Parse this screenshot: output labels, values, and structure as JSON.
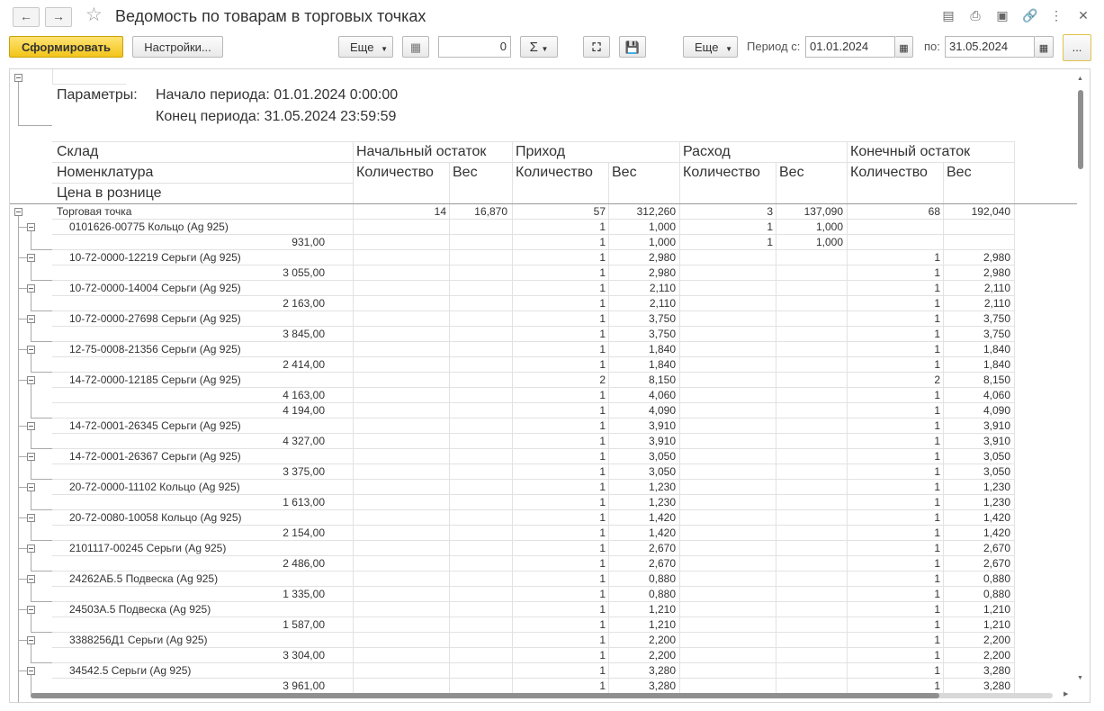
{
  "window": {
    "title": "Ведомость по товарам в торговых точках"
  },
  "toolbar": {
    "generate_label": "Сформировать",
    "settings_label": "Настройки...",
    "more1_label": "Еще",
    "number_value": "0",
    "sum_label": "Σ",
    "more2_label": "Еще",
    "period_from_label": "Период с:",
    "period_from_value": "01.01.2024",
    "period_to_label": "по:",
    "period_to_value": "31.05.2024",
    "ellipsis_label": "..."
  },
  "params": {
    "label": "Параметры:",
    "start": "Начало периода: 01.01.2024 0:00:00",
    "end": "Конец периода: 31.05.2024 23:59:59"
  },
  "headers": {
    "warehouse": "Склад",
    "nomenclature": "Номенклатура",
    "retail_price": "Цена в рознице",
    "opening": "Начальный остаток",
    "income": "Приход",
    "expense": "Расход",
    "closing": "Конечный остаток",
    "qty": "Количество",
    "weight": "Вес"
  },
  "total": {
    "name": "Торговая точка",
    "open_qty": "14",
    "open_w": "16,870",
    "in_qty": "57",
    "in_w": "312,260",
    "out_qty": "3",
    "out_w": "137,090",
    "close_qty": "68",
    "close_w": "192,040"
  },
  "rows": [
    {
      "name": "0101626-00775 Кольцо (Ag 925)",
      "in_qty": "1",
      "in_w": "1,000",
      "out_qty": "1",
      "out_w": "1,000",
      "close_qty": "",
      "close_w": "",
      "prices": [
        {
          "price": "931,00",
          "in_qty": "1",
          "in_w": "1,000",
          "out_qty": "1",
          "out_w": "1,000",
          "close_qty": "",
          "close_w": ""
        }
      ]
    },
    {
      "name": "10-72-0000-12219 Серьги (Ag 925)",
      "in_qty": "1",
      "in_w": "2,980",
      "out_qty": "",
      "out_w": "",
      "close_qty": "1",
      "close_w": "2,980",
      "prices": [
        {
          "price": "3 055,00",
          "in_qty": "1",
          "in_w": "2,980",
          "out_qty": "",
          "out_w": "",
          "close_qty": "1",
          "close_w": "2,980"
        }
      ]
    },
    {
      "name": "10-72-0000-14004 Серьги (Ag 925)",
      "in_qty": "1",
      "in_w": "2,110",
      "out_qty": "",
      "out_w": "",
      "close_qty": "1",
      "close_w": "2,110",
      "prices": [
        {
          "price": "2 163,00",
          "in_qty": "1",
          "in_w": "2,110",
          "out_qty": "",
          "out_w": "",
          "close_qty": "1",
          "close_w": "2,110"
        }
      ]
    },
    {
      "name": "10-72-0000-27698 Серьги (Ag 925)",
      "in_qty": "1",
      "in_w": "3,750",
      "out_qty": "",
      "out_w": "",
      "close_qty": "1",
      "close_w": "3,750",
      "prices": [
        {
          "price": "3 845,00",
          "in_qty": "1",
          "in_w": "3,750",
          "out_qty": "",
          "out_w": "",
          "close_qty": "1",
          "close_w": "3,750"
        }
      ]
    },
    {
      "name": "12-75-0008-21356 Серьги (Ag 925)",
      "in_qty": "1",
      "in_w": "1,840",
      "out_qty": "",
      "out_w": "",
      "close_qty": "1",
      "close_w": "1,840",
      "prices": [
        {
          "price": "2 414,00",
          "in_qty": "1",
          "in_w": "1,840",
          "out_qty": "",
          "out_w": "",
          "close_qty": "1",
          "close_w": "1,840"
        }
      ]
    },
    {
      "name": "14-72-0000-12185 Серьги (Ag 925)",
      "in_qty": "2",
      "in_w": "8,150",
      "out_qty": "",
      "out_w": "",
      "close_qty": "2",
      "close_w": "8,150",
      "prices": [
        {
          "price": "4 163,00",
          "in_qty": "1",
          "in_w": "4,060",
          "out_qty": "",
          "out_w": "",
          "close_qty": "1",
          "close_w": "4,060"
        },
        {
          "price": "4 194,00",
          "in_qty": "1",
          "in_w": "4,090",
          "out_qty": "",
          "out_w": "",
          "close_qty": "1",
          "close_w": "4,090"
        }
      ]
    },
    {
      "name": "14-72-0001-26345 Серьги (Ag 925)",
      "in_qty": "1",
      "in_w": "3,910",
      "out_qty": "",
      "out_w": "",
      "close_qty": "1",
      "close_w": "3,910",
      "prices": [
        {
          "price": "4 327,00",
          "in_qty": "1",
          "in_w": "3,910",
          "out_qty": "",
          "out_w": "",
          "close_qty": "1",
          "close_w": "3,910"
        }
      ]
    },
    {
      "name": "14-72-0001-26367 Серьги (Ag 925)",
      "in_qty": "1",
      "in_w": "3,050",
      "out_qty": "",
      "out_w": "",
      "close_qty": "1",
      "close_w": "3,050",
      "prices": [
        {
          "price": "3 375,00",
          "in_qty": "1",
          "in_w": "3,050",
          "out_qty": "",
          "out_w": "",
          "close_qty": "1",
          "close_w": "3,050"
        }
      ]
    },
    {
      "name": "20-72-0000-11102 Кольцо (Ag 925)",
      "in_qty": "1",
      "in_w": "1,230",
      "out_qty": "",
      "out_w": "",
      "close_qty": "1",
      "close_w": "1,230",
      "prices": [
        {
          "price": "1 613,00",
          "in_qty": "1",
          "in_w": "1,230",
          "out_qty": "",
          "out_w": "",
          "close_qty": "1",
          "close_w": "1,230"
        }
      ]
    },
    {
      "name": "20-72-0080-10058 Кольцо (Ag 925)",
      "in_qty": "1",
      "in_w": "1,420",
      "out_qty": "",
      "out_w": "",
      "close_qty": "1",
      "close_w": "1,420",
      "prices": [
        {
          "price": "2 154,00",
          "in_qty": "1",
          "in_w": "1,420",
          "out_qty": "",
          "out_w": "",
          "close_qty": "1",
          "close_w": "1,420"
        }
      ]
    },
    {
      "name": "2101117-00245 Серьги (Ag 925)",
      "in_qty": "1",
      "in_w": "2,670",
      "out_qty": "",
      "out_w": "",
      "close_qty": "1",
      "close_w": "2,670",
      "prices": [
        {
          "price": "2 486,00",
          "in_qty": "1",
          "in_w": "2,670",
          "out_qty": "",
          "out_w": "",
          "close_qty": "1",
          "close_w": "2,670"
        }
      ]
    },
    {
      "name": "24262АБ.5 Подвеска (Ag 925)",
      "in_qty": "1",
      "in_w": "0,880",
      "out_qty": "",
      "out_w": "",
      "close_qty": "1",
      "close_w": "0,880",
      "prices": [
        {
          "price": "1 335,00",
          "in_qty": "1",
          "in_w": "0,880",
          "out_qty": "",
          "out_w": "",
          "close_qty": "1",
          "close_w": "0,880"
        }
      ]
    },
    {
      "name": "24503А.5 Подвеска (Ag 925)",
      "in_qty": "1",
      "in_w": "1,210",
      "out_qty": "",
      "out_w": "",
      "close_qty": "1",
      "close_w": "1,210",
      "prices": [
        {
          "price": "1 587,00",
          "in_qty": "1",
          "in_w": "1,210",
          "out_qty": "",
          "out_w": "",
          "close_qty": "1",
          "close_w": "1,210"
        }
      ]
    },
    {
      "name": "3388256Д1 Серьги (Ag 925)",
      "in_qty": "1",
      "in_w": "2,200",
      "out_qty": "",
      "out_w": "",
      "close_qty": "1",
      "close_w": "2,200",
      "prices": [
        {
          "price": "3 304,00",
          "in_qty": "1",
          "in_w": "2,200",
          "out_qty": "",
          "out_w": "",
          "close_qty": "1",
          "close_w": "2,200"
        }
      ]
    },
    {
      "name": "34542.5 Серьги (Ag 925)",
      "in_qty": "1",
      "in_w": "3,280",
      "out_qty": "",
      "out_w": "",
      "close_qty": "1",
      "close_w": "3,280",
      "prices": [
        {
          "price": "3 961,00",
          "in_qty": "1",
          "in_w": "3,280",
          "out_qty": "",
          "out_w": "",
          "close_qty": "1",
          "close_w": "3,280"
        }
      ]
    }
  ]
}
